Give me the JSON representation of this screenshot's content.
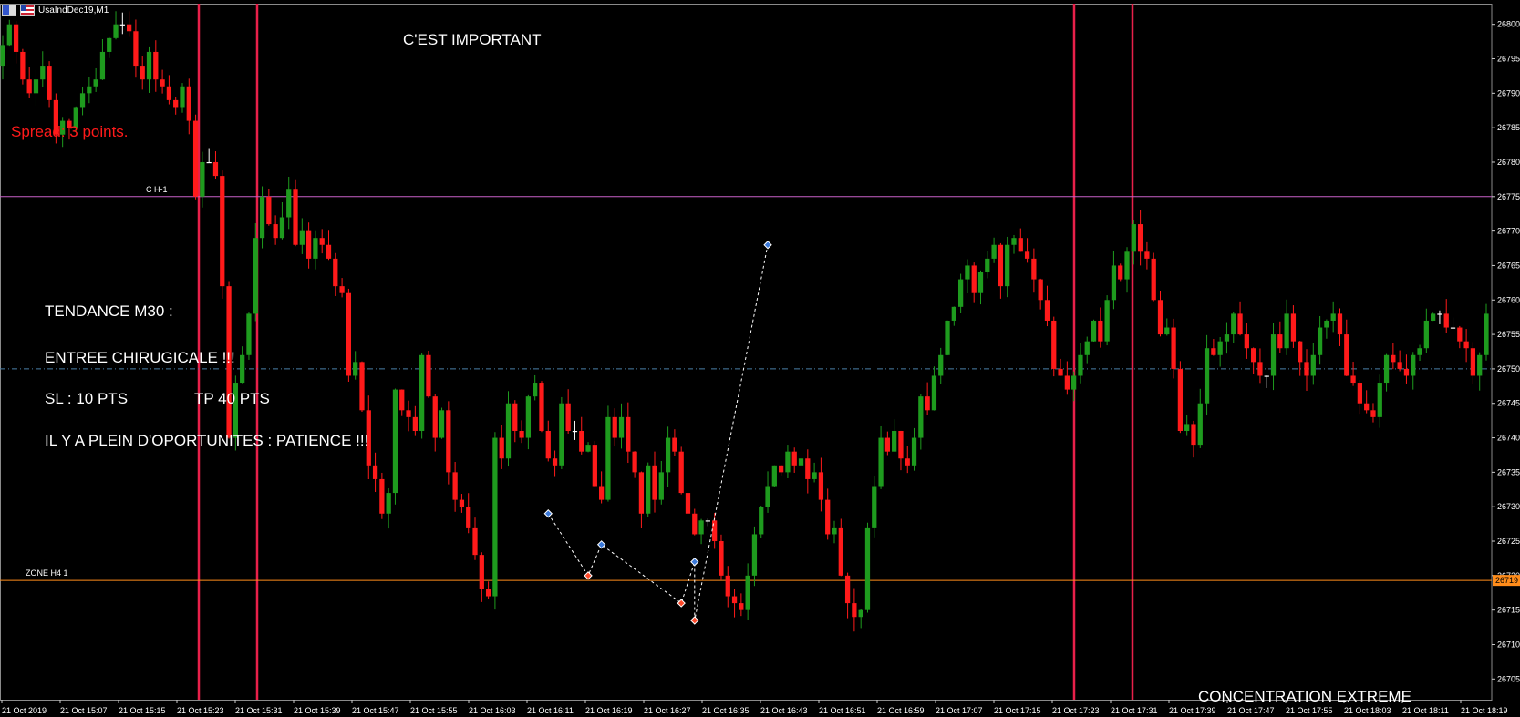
{
  "window": {
    "title": "UsaIndDec19,M1",
    "icon_left": "chart-type-icon",
    "icon_right": "us-flag-icon"
  },
  "annotations": {
    "top": "C'EST IMPORTANT",
    "spread": "Spread: 3 points.",
    "tendance": "TENDANCE M30 :",
    "entree": "ENTREE CHIRUGICALE !!!",
    "sl": "SL : 10 PTS",
    "tp": "TP 40 PTS",
    "patience": "IL Y A PLEIN D'OPORTUNITES : PATIENCE !!!",
    "concentration": "CONCENTRATION EXTREME"
  },
  "colors": {
    "background": "#000000",
    "bull": "#1e9b1e",
    "bear": "#ff1a1a",
    "doji": "#ffffff",
    "vertical_lines": "#e8204a",
    "level_ch1": "#c860c8",
    "level_zone": "#ff8c1a",
    "dash_level": "#4a7fa8",
    "current_price_tag": "#ff8c1a"
  },
  "chart_data": {
    "type": "candlestick",
    "symbol": "UsaIndDec19",
    "timeframe": "M1",
    "ylim": [
      26702,
      26803
    ],
    "yticks": [
      26705,
      26710,
      26715,
      26720,
      26725,
      26730,
      26735,
      26740,
      26745,
      26750,
      26755,
      26760,
      26765,
      26770,
      26775,
      26780,
      26785,
      26790,
      26795,
      26800
    ],
    "xticks": [
      "21 Oct 2019",
      "21 Oct 15:07",
      "21 Oct 15:15",
      "21 Oct 15:23",
      "21 Oct 15:31",
      "21 Oct 15:39",
      "21 Oct 15:47",
      "21 Oct 15:55",
      "21 Oct 16:03",
      "21 Oct 16:11",
      "21 Oct 16:19",
      "21 Oct 16:27",
      "21 Oct 16:35",
      "21 Oct 16:43",
      "21 Oct 16:51",
      "21 Oct 16:59",
      "21 Oct 17:07",
      "21 Oct 17:15",
      "21 Oct 17:23",
      "21 Oct 17:31",
      "21 Oct 17:39",
      "21 Oct 17:47",
      "21 Oct 17:55",
      "21 Oct 18:03",
      "21 Oct 18:11",
      "21 Oct 18:19"
    ],
    "current_price_label": "26719",
    "horizontal_levels": [
      {
        "name": "C H-1",
        "price": 26775.0,
        "style": "solid"
      },
      {
        "name": "ZONE H4 1",
        "price": 26719.3,
        "style": "solid"
      },
      {
        "name": "",
        "price": 26750.0,
        "style": "dash-dot"
      }
    ],
    "vertical_lines_at": [
      "21 Oct 15:23",
      "21 Oct 15:31",
      "21 Oct 17:23",
      "21 Oct 17:31"
    ],
    "swing_points": [
      {
        "time": "21 Oct 16:27",
        "price": 26729,
        "kind": "high"
      },
      {
        "time": "21 Oct 16:33",
        "price": 26720,
        "kind": "low"
      },
      {
        "time": "21 Oct 16:35",
        "price": 26724.5,
        "kind": "high"
      },
      {
        "time": "21 Oct 16:47",
        "price": 26716,
        "kind": "low"
      },
      {
        "time": "21 Oct 16:49",
        "price": 26722,
        "kind": "high"
      },
      {
        "time": "21 Oct 16:49",
        "price": 26713.5,
        "kind": "low"
      },
      {
        "time": "21 Oct 17:00",
        "price": 26768,
        "kind": "high"
      }
    ],
    "closes": [
      26797,
      26800,
      26796,
      26792,
      26790,
      26792,
      26794,
      26789,
      26784,
      26786,
      26785,
      26788,
      26790,
      26791,
      26792,
      26796,
      26798,
      26800,
      26800,
      26799,
      26794,
      26792,
      26796,
      26792,
      26791,
      26789,
      26788,
      26791,
      26786,
      26775,
      26780,
      26780,
      26778,
      26762,
      26740,
      26748,
      26752,
      26758,
      26769,
      26775,
      26771,
      26769,
      26772,
      26776,
      26768,
      26770,
      26766,
      26769,
      26768,
      26766,
      26762,
      26761,
      26749,
      26751,
      26744,
      26736,
      26734,
      26729,
      26732,
      26747,
      26744,
      26743,
      26741,
      26752,
      26746,
      26740,
      26744,
      26735,
      26731,
      26730,
      26727,
      26723,
      26718,
      26717,
      26740,
      26737,
      26745,
      26741,
      26740,
      26746,
      26748,
      26741,
      26737,
      26736,
      26745,
      26741,
      26741,
      26738,
      26739,
      26733,
      26731,
      26743,
      26740,
      26743,
      26738,
      26735,
      26729,
      26736,
      26731,
      26735,
      26740,
      26738,
      26732,
      26729,
      26726,
      26728,
      26728,
      26725,
      26720,
      26717,
      26716,
      26715,
      26720,
      26726,
      26730,
      26733,
      26736,
      26735,
      26738,
      26736,
      26737,
      26734,
      26735,
      26731,
      26726,
      26727,
      26720,
      26716,
      26714,
      26715,
      26727,
      26733,
      26740,
      26738,
      26741,
      26737,
      26736,
      26740,
      26746,
      26744,
      26749,
      26752,
      26757,
      26759,
      26763,
      26765,
      26761,
      26764,
      26766,
      26768,
      26762,
      26768,
      26769,
      26767,
      26766,
      26763,
      26760,
      26757,
      26750,
      26749,
      26747,
      26749,
      26752,
      26754,
      26757,
      26754,
      26760,
      26765,
      26763,
      26767,
      26771,
      26767,
      26766,
      26760,
      26755,
      26756,
      26750,
      26741,
      26742,
      26739,
      26745,
      26753,
      26752,
      26754,
      26755,
      26758,
      26755,
      26753,
      26751,
      26749,
      26749,
      26755,
      26753,
      26758,
      26754,
      26751,
      26749,
      26752,
      26756,
      26757,
      26758,
      26755,
      26749,
      26748,
      26745,
      26744,
      26743,
      26748,
      26752,
      26751,
      26750,
      26749,
      26752,
      26753,
      26757,
      26758,
      26758,
      26756,
      26756,
      26754,
      26753,
      26749,
      26752,
      26758
    ],
    "xlabel": "",
    "ylabel": ""
  }
}
